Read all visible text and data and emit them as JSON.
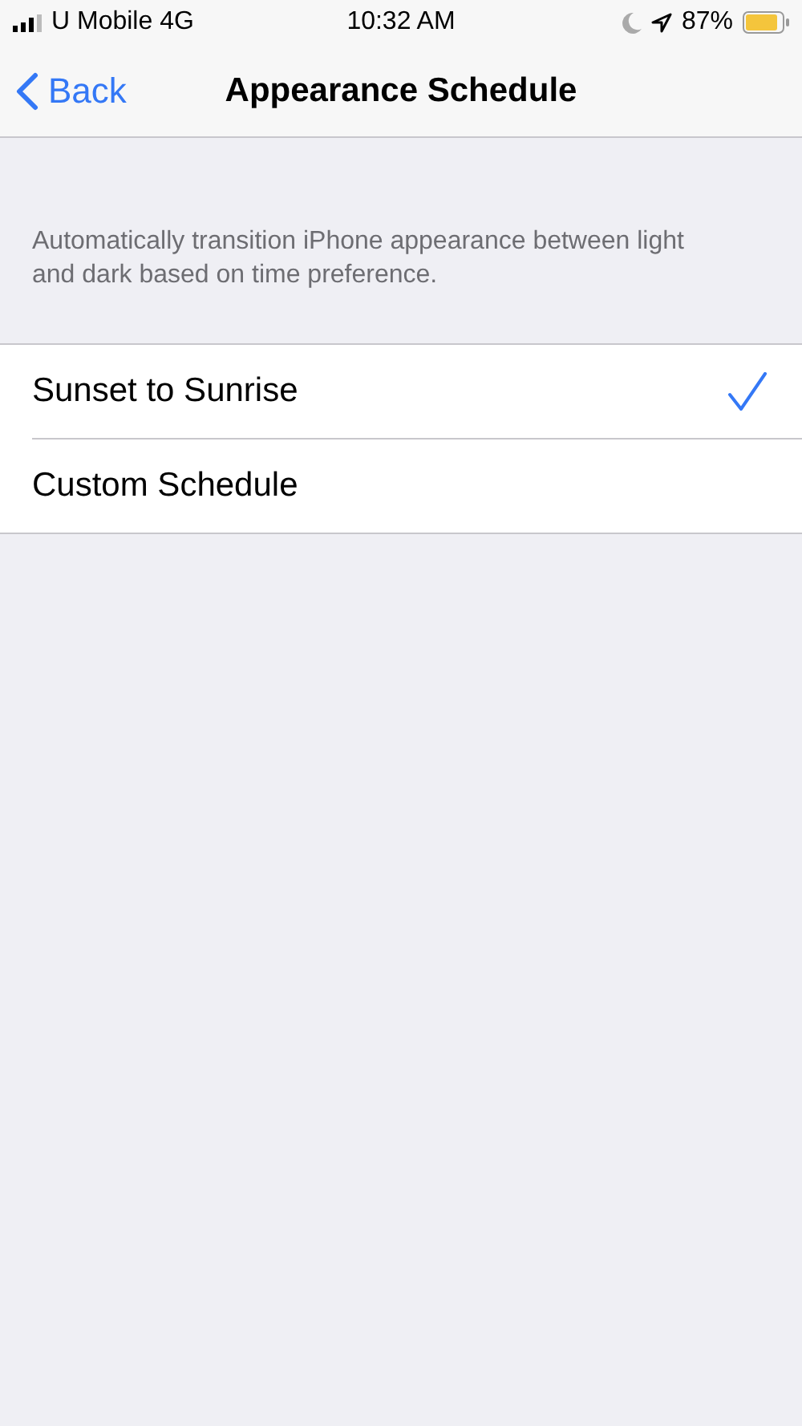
{
  "status_bar": {
    "carrier": "U Mobile 4G",
    "time": "10:32 AM",
    "battery": "87%"
  },
  "nav": {
    "back": "Back",
    "title": "Appearance Schedule"
  },
  "description": "Automatically transition iPhone appearance between light and dark based on time preference.",
  "options": [
    {
      "label": "Sunset to Sunrise",
      "selected": true
    },
    {
      "label": "Custom Schedule",
      "selected": false
    }
  ]
}
